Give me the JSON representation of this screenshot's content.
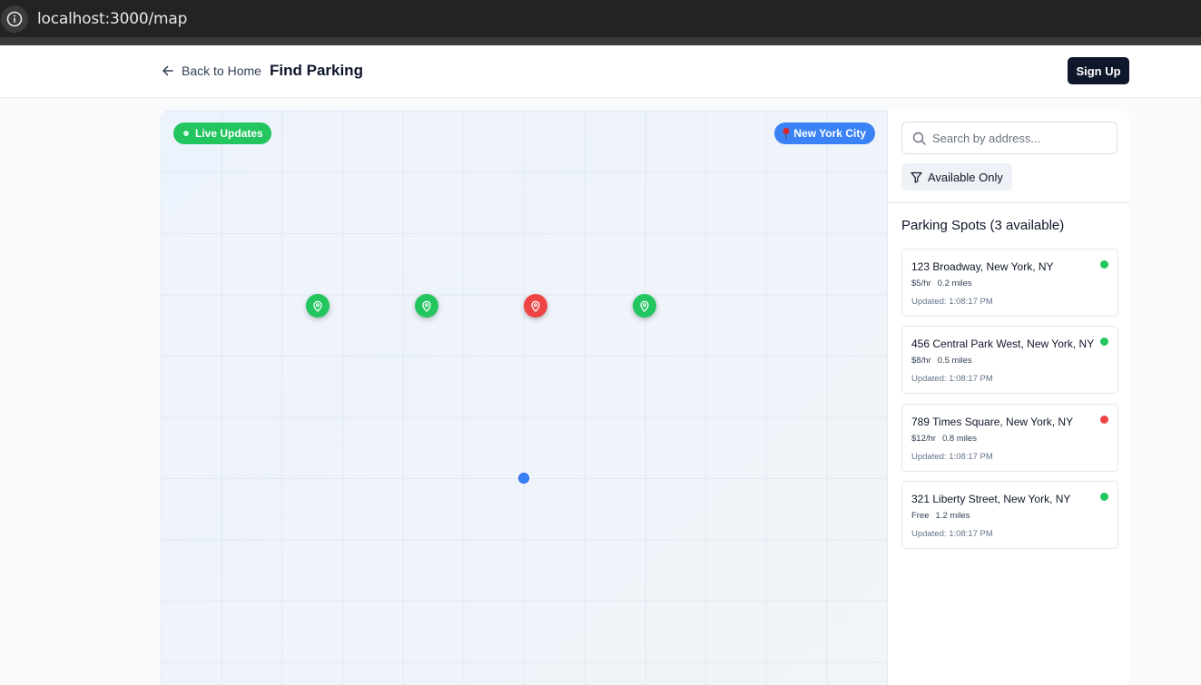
{
  "browser": {
    "url": "localhost:3000/map"
  },
  "header": {
    "back_label": "Back to Home",
    "title": "Find Parking",
    "signup_label": "Sign Up"
  },
  "map": {
    "live_badge": "Live Updates",
    "city_badge": "New York City",
    "markers": [
      {
        "status": "available",
        "color": "#22c55e"
      },
      {
        "status": "available",
        "color": "#22c55e"
      },
      {
        "status": "occupied",
        "color": "#ef4444"
      },
      {
        "status": "available",
        "color": "#22c55e"
      }
    ],
    "user_location_color": "#3b82f6"
  },
  "sidebar": {
    "search_placeholder": "Search by address...",
    "filter_label": "Available Only",
    "heading": "Parking Spots (3 available)",
    "spots": [
      {
        "address": "123 Broadway, New York, NY",
        "price": "$5/hr",
        "distance": "0.2 miles",
        "updated": "Updated: 1:08:17 PM",
        "status": "available",
        "status_color": "#22c55e"
      },
      {
        "address": "456 Central Park West, New York, NY",
        "price": "$8/hr",
        "distance": "0.5 miles",
        "updated": "Updated: 1:08:17 PM",
        "status": "available",
        "status_color": "#22c55e"
      },
      {
        "address": "789 Times Square, New York, NY",
        "price": "$12/hr",
        "distance": "0.8 miles",
        "updated": "Updated: 1:08:17 PM",
        "status": "occupied",
        "status_color": "#ef4444"
      },
      {
        "address": "321 Liberty Street, New York, NY",
        "price": "Free",
        "distance": "1.2 miles",
        "updated": "Updated: 1:08:17 PM",
        "status": "available",
        "status_color": "#22c55e"
      }
    ]
  }
}
